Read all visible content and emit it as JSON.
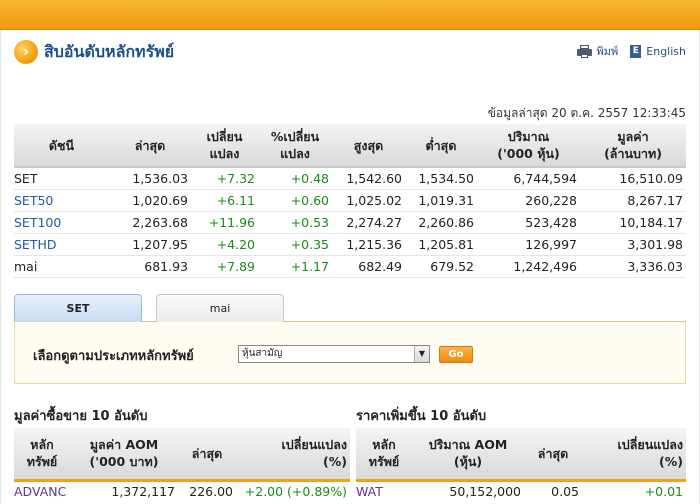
{
  "page": {
    "title": "สิบอันดับหลักทรัพย์",
    "print_label": "พิมพ์",
    "lang_label": "English",
    "updated": "ข้อมูลล่าสุด 20 ต.ค. 2557 12:33:45"
  },
  "index_table": {
    "headers": {
      "index": "ดัชนี",
      "last": "ล่าสุด",
      "change_1": "เปลี่ยน",
      "change_2": "แปลง",
      "pct_1": "%เปลี่ยน",
      "pct_2": "แปลง",
      "high": "สูงสุด",
      "low": "ต่ำสุด",
      "volume_1": "ปริมาณ",
      "volume_2": "('000 หุ้น)",
      "value_1": "มูลค่า",
      "value_2": "(ล้านบาท)"
    },
    "rows": [
      {
        "name": "SET",
        "last": "1,536.03",
        "change": "+7.32",
        "pct": "+0.48",
        "high": "1,542.60",
        "low": "1,534.50",
        "volume": "6,744,594",
        "value": "16,510.09"
      },
      {
        "name": "SET50",
        "last": "1,020.69",
        "change": "+6.11",
        "pct": "+0.60",
        "high": "1,025.02",
        "low": "1,019.31",
        "volume": "260,228",
        "value": "8,267.17"
      },
      {
        "name": "SET100",
        "last": "2,263.68",
        "change": "+11.96",
        "pct": "+0.53",
        "high": "2,274.27",
        "low": "2,260.86",
        "volume": "523,428",
        "value": "10,184.17"
      },
      {
        "name": "SETHD",
        "last": "1,207.95",
        "change": "+4.20",
        "pct": "+0.35",
        "high": "1,215.36",
        "low": "1,205.81",
        "volume": "126,997",
        "value": "3,301.98"
      },
      {
        "name": "mai",
        "last": "681.93",
        "change": "+7.89",
        "pct": "+1.17",
        "high": "682.49",
        "low": "679.52",
        "volume": "1,242,496",
        "value": "3,336.03"
      }
    ]
  },
  "tabs": {
    "set": "SET",
    "mai": "mai"
  },
  "filter": {
    "label": "เลือกดูตามประเภทหลักทรัพย์",
    "selected": "หุ้นสามัญ",
    "go": "Go"
  },
  "top_value": {
    "title": "มูลค่าซื้อขาย 10 อันดับ",
    "headers": {
      "sym_1": "หลัก",
      "sym_2": "ทรัพย์",
      "aom_1": "มูลค่า AOM",
      "aom_2": "('000 บาท)",
      "last": "ล่าสุด",
      "chg_1": "เปลี่ยนแปลง",
      "chg_2": "(%)"
    },
    "rows": [
      {
        "symbol": "ADVANC",
        "aom": "1,372,117",
        "last": "226.00",
        "change": "+2.00 (+0.89%)"
      }
    ]
  },
  "top_gainers": {
    "title": "ราคาเพิ่มขึ้น 10 อันดับ",
    "headers": {
      "sym_1": "หลัก",
      "sym_2": "ทรัพย์",
      "vol_1": "ปริมาณ AOM",
      "vol_2": "(หุ้น)",
      "last": "ล่าสุด",
      "chg_1": "เปลี่ยนแปลง",
      "chg_2": "(%)"
    },
    "rows": [
      {
        "symbol": "WAT",
        "volume": "50,152,000",
        "last": "0.05",
        "change": "+0.01"
      }
    ]
  },
  "colors": {
    "accent": "#f1a20e",
    "link": "#1f5aa8",
    "positive": "#1a8a1a"
  }
}
